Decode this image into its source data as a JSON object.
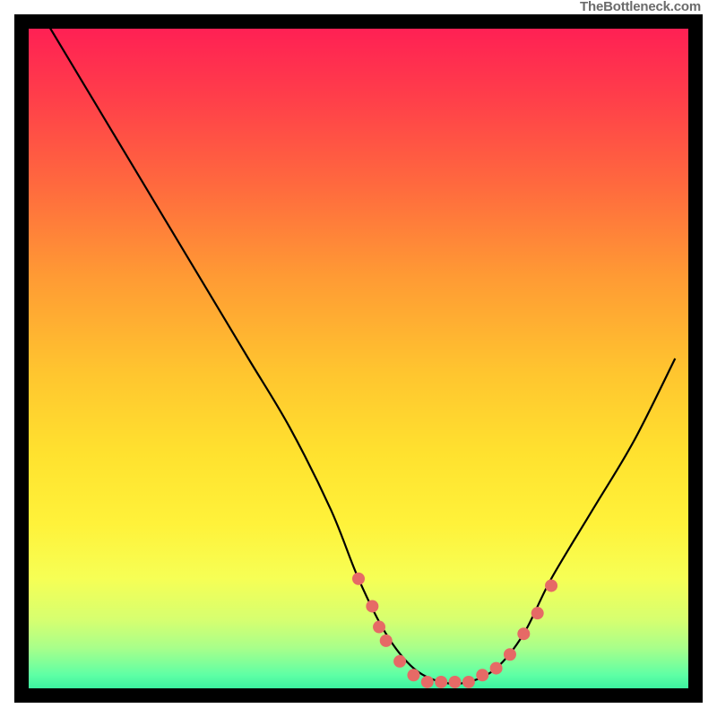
{
  "watermark": "TheBottleneck.com",
  "colors": {
    "frame": "#000000",
    "bead": "#e66a66",
    "gradient_top": "#ff1a56",
    "gradient_bottom": "#18e59a"
  },
  "chart_data": {
    "type": "line",
    "title": "",
    "xlabel": "",
    "ylabel": "",
    "xlim": [
      0,
      100
    ],
    "ylim": [
      0,
      100
    ],
    "series": [
      {
        "name": "curve",
        "x": [
          4,
          10,
          16,
          22,
          28,
          34,
          40,
          46,
          50,
          54,
          58,
          62,
          66,
          70,
          74,
          78,
          84,
          90,
          96
        ],
        "y": [
          100,
          90,
          80,
          70,
          60,
          50,
          40,
          28,
          18,
          10,
          5,
          3,
          3,
          5,
          10,
          18,
          28,
          38,
          50
        ]
      }
    ],
    "beads": [
      {
        "x": 50,
        "y": 18
      },
      {
        "x": 52,
        "y": 14
      },
      {
        "x": 53,
        "y": 11
      },
      {
        "x": 54,
        "y": 9
      },
      {
        "x": 56,
        "y": 6
      },
      {
        "x": 58,
        "y": 4
      },
      {
        "x": 60,
        "y": 3
      },
      {
        "x": 62,
        "y": 3
      },
      {
        "x": 64,
        "y": 3
      },
      {
        "x": 66,
        "y": 3
      },
      {
        "x": 68,
        "y": 4
      },
      {
        "x": 70,
        "y": 5
      },
      {
        "x": 72,
        "y": 7
      },
      {
        "x": 74,
        "y": 10
      },
      {
        "x": 76,
        "y": 13
      },
      {
        "x": 78,
        "y": 17
      }
    ]
  }
}
